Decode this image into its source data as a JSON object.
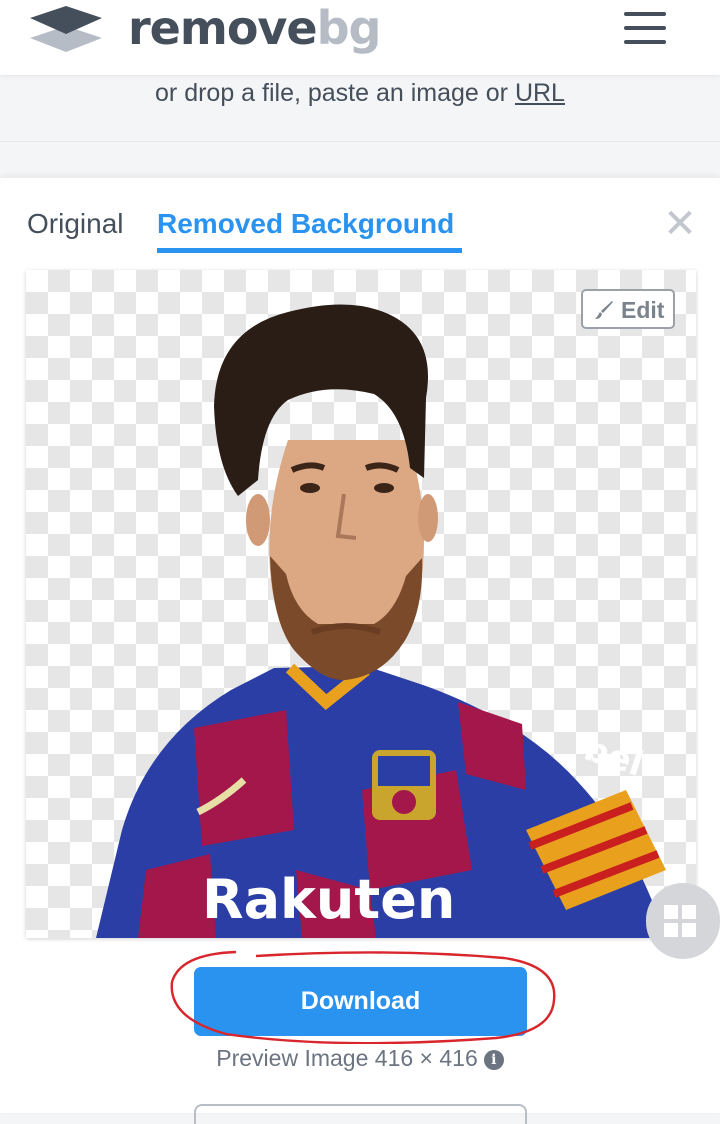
{
  "header": {
    "logo_word_1": "remove",
    "logo_word_2": "bg",
    "logo_icon": "layers-icon",
    "menu_icon": "hamburger-menu-icon"
  },
  "upload": {
    "drop_text": "or drop a file, paste an image or ",
    "url_link": "URL"
  },
  "result": {
    "tabs": [
      {
        "label": "Original",
        "active": false
      },
      {
        "label": "Removed Background",
        "active": true
      }
    ],
    "close_icon": "close-icon",
    "edit_label": "Edit",
    "edit_icon": "brush-icon",
    "download_label": "Download",
    "preview_info": "Preview Image 416 × 416",
    "info_icon": "info-icon",
    "info_glyph": "i"
  },
  "colors": {
    "accent": "#2a93f0",
    "text_dark": "#454f5b",
    "annotation": "#d8262c"
  }
}
